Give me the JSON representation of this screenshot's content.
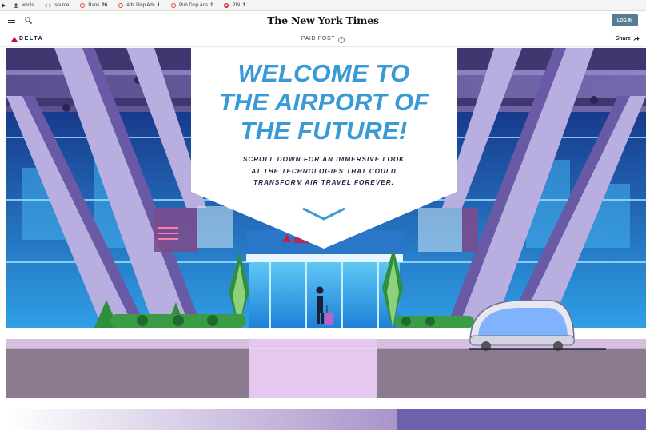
{
  "seo_toolbar": {
    "items": [
      {
        "label": "whois",
        "value": "",
        "icon": "user-icon"
      },
      {
        "label": "source",
        "value": "",
        "icon": "code-icon"
      },
      {
        "label": "Rank",
        "value": "26",
        "icon": "ring-icon"
      },
      {
        "label": "Adv Disp Ads",
        "value": "1",
        "icon": "ring-icon"
      },
      {
        "label": "Pub Disp Ads",
        "value": "1",
        "icon": "ring-icon"
      },
      {
        "label": "PIN",
        "value": "1",
        "icon": "pin-icon"
      }
    ]
  },
  "nyt_header": {
    "logo_text": "The New York Times",
    "login_label": "LOG IN"
  },
  "paid_bar": {
    "brand": "DELTA",
    "label": "PAID POST",
    "help": "?",
    "share_label": "Share"
  },
  "hero": {
    "headline_lines": [
      "WELCOME TO",
      "THE AIRPORT OF",
      "THE FUTURE!"
    ],
    "subhead_lines": [
      "SCROLL DOWN FOR AN IMMERSIVE LOOK",
      "AT THE TECHNOLOGIES THAT COULD",
      "TRANSFORM AIR TRAVEL FOREVER."
    ],
    "colors": {
      "headline": "#3a9ad5",
      "subhead": "#1f2340",
      "beam": "#6a5aa6",
      "glass": "#2f9fe6",
      "floor": "#8c7a8e"
    }
  }
}
